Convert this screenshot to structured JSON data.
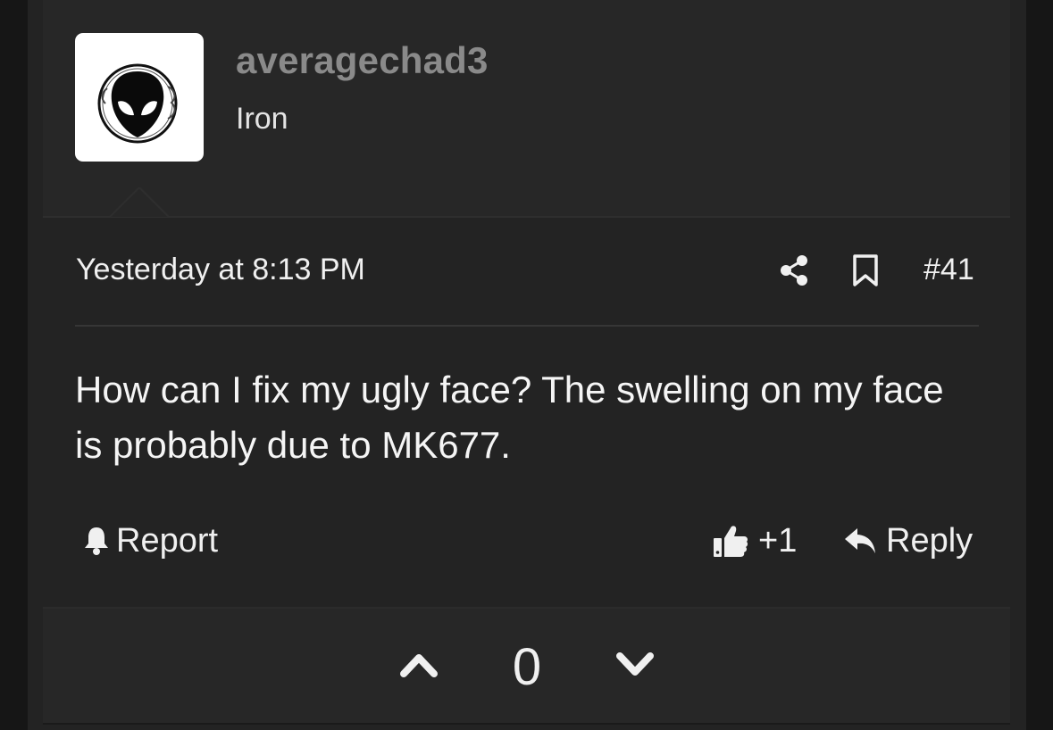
{
  "post": {
    "username": "averagechad3",
    "user_title": "Iron",
    "date": "Yesterday at 8:13 PM",
    "number": "#41",
    "body": "How can I fix my ugly face? The swelling on my face is probably due to MK677.",
    "report_label": "Report",
    "reaction_count": "+1",
    "reply_label": "Reply",
    "vote_score": "0"
  },
  "icons": {
    "avatar": "alien-head-avatar",
    "share": "share-icon",
    "bookmark": "bookmark-icon",
    "report": "bell-icon",
    "like": "thumbs-up-icon",
    "reply": "reply-arrow-icon",
    "upvote": "chevron-up-icon",
    "downvote": "chevron-down-icon"
  },
  "colors": {
    "background": "#161616",
    "card": "#232323",
    "panel": "#272727",
    "username": "#8a8a8a",
    "text": "#f0f0f0"
  }
}
